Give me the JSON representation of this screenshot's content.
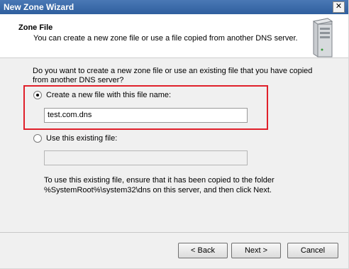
{
  "window": {
    "title": "New Zone Wizard",
    "close_glyph": "✕"
  },
  "header": {
    "title": "Zone File",
    "subtitle": "You can create a new zone file or use a file copied from another DNS server.",
    "icon": "server-icon"
  },
  "content": {
    "question": "Do you want to create a new zone file or use an existing file that you have copied from another DNS server?",
    "options": [
      {
        "label": "Create a new file with this file name:",
        "selected": true
      },
      {
        "label": "Use this existing file:",
        "selected": false
      }
    ],
    "new_file_value": "test.com.dns",
    "existing_file_value": "",
    "info": "To use this existing file, ensure that it has been copied to the folder %SystemRoot%\\system32\\dns on this server, and then click Next."
  },
  "buttons": {
    "back": "< Back",
    "next": "Next >",
    "cancel": "Cancel"
  },
  "colors": {
    "titlebar": "#2f5f9e",
    "highlight_border": "#e0202a"
  }
}
